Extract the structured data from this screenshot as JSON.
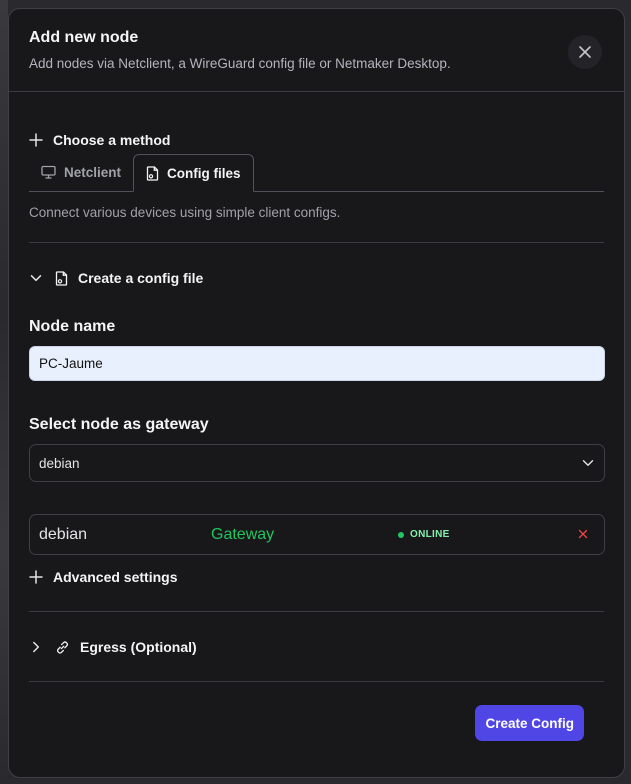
{
  "modal": {
    "title": "Add new node",
    "subtitle": "Add nodes via Netclient, a WireGuard config file or Netmaker Desktop."
  },
  "method": {
    "label": "Choose a method",
    "tabs": [
      {
        "label": "Netclient",
        "icon": "monitor-icon",
        "active": false
      },
      {
        "label": "Config files",
        "icon": "file-icon",
        "active": true
      }
    ],
    "description": "Connect various devices using simple client configs."
  },
  "config_section": {
    "label": "Create a config file",
    "node_name_label": "Node name",
    "node_name_value": "PC-Jaume",
    "gateway_label": "Select node as gateway",
    "gateway_selected": "debian",
    "gateway_node": {
      "name": "debian",
      "role": "Gateway",
      "status": "ONLINE"
    },
    "advanced_label": "Advanced settings"
  },
  "egress": {
    "label": "Egress (Optional)"
  },
  "actions": {
    "create_label": "Create Config"
  },
  "colors": {
    "accent": "#4f46e5",
    "online": "#22c55e",
    "remove": "#ef4444"
  }
}
